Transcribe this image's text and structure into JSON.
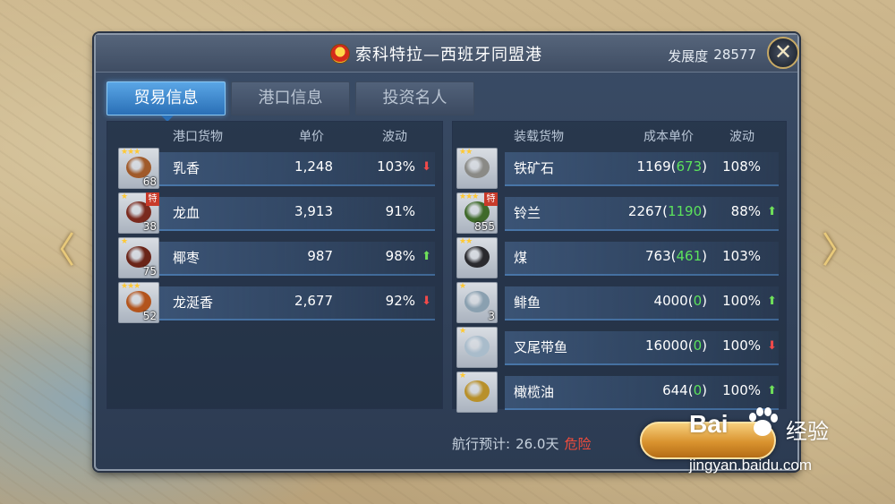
{
  "port": {
    "title": "索科特拉—西班牙同盟港",
    "development_label": "发展度",
    "development_value": "28577"
  },
  "close_glyph": "✕",
  "nav": {
    "left_glyph": "〈",
    "right_glyph": "〉"
  },
  "tabs": [
    {
      "label": "贸易信息",
      "active": true
    },
    {
      "label": "港口信息",
      "active": false
    },
    {
      "label": "投资名人",
      "active": false
    }
  ],
  "port_goods": {
    "headers": {
      "goods": "港口货物",
      "price": "单价",
      "fluctuation": "波动"
    },
    "rows": [
      {
        "name": "乳香",
        "stars": "★★★",
        "qty": "68",
        "special": "",
        "price": "1,248",
        "fluctuation": "103%",
        "trend": "down",
        "art_color": "#a05a2a"
      },
      {
        "name": "龙血",
        "stars": "★",
        "qty": "38",
        "special": "特",
        "price": "3,913",
        "fluctuation": "91%",
        "trend": "",
        "art_color": "#7a2a1e"
      },
      {
        "name": "椰枣",
        "stars": "★",
        "qty": "75",
        "special": "",
        "price": "987",
        "fluctuation": "98%",
        "trend": "up",
        "art_color": "#6a2418"
      },
      {
        "name": "龙涎香",
        "stars": "★★★",
        "qty": "52",
        "special": "",
        "price": "2,677",
        "fluctuation": "92%",
        "trend": "down",
        "art_color": "#b3541c"
      }
    ]
  },
  "cargo": {
    "headers": {
      "goods": "装载货物",
      "cost": "成本单价",
      "fluctuation": "波动"
    },
    "rows": [
      {
        "name": "铁矿石",
        "stars": "★★",
        "qty": "",
        "special": "",
        "cost": "1169",
        "gain": "673",
        "fluctuation": "108%",
        "trend": "",
        "art_color": "#8a8a86"
      },
      {
        "name": "铃兰",
        "stars": "★★★",
        "qty": "855",
        "special": "特",
        "cost": "2267",
        "gain": "1190",
        "fluctuation": "88%",
        "trend": "up",
        "art_color": "#3f6a2a"
      },
      {
        "name": "煤",
        "stars": "★★",
        "qty": "",
        "special": "",
        "cost": "763",
        "gain": "461",
        "fluctuation": "103%",
        "trend": "",
        "art_color": "#2a2a2e"
      },
      {
        "name": "鲱鱼",
        "stars": "★",
        "qty": "3",
        "special": "",
        "cost": "4000",
        "gain": "0",
        "fluctuation": "100%",
        "trend": "up",
        "art_color": "#8aa0b0"
      },
      {
        "name": "叉尾带鱼",
        "stars": "★",
        "qty": "",
        "special": "",
        "cost": "16000",
        "gain": "0",
        "fluctuation": "100%",
        "trend": "down",
        "art_color": "#a9bccb"
      },
      {
        "name": "橄榄油",
        "stars": "★",
        "qty": "",
        "special": "",
        "cost": "644",
        "gain": "0",
        "fluctuation": "100%",
        "trend": "up",
        "art_color": "#b8902a"
      }
    ]
  },
  "footer": {
    "voyage_label": "航行预计:",
    "voyage_days": "26.0天",
    "danger": "危险"
  },
  "watermark": {
    "brand": "Bai",
    "brand2": "经验",
    "url": "jingyan.baidu.com"
  }
}
